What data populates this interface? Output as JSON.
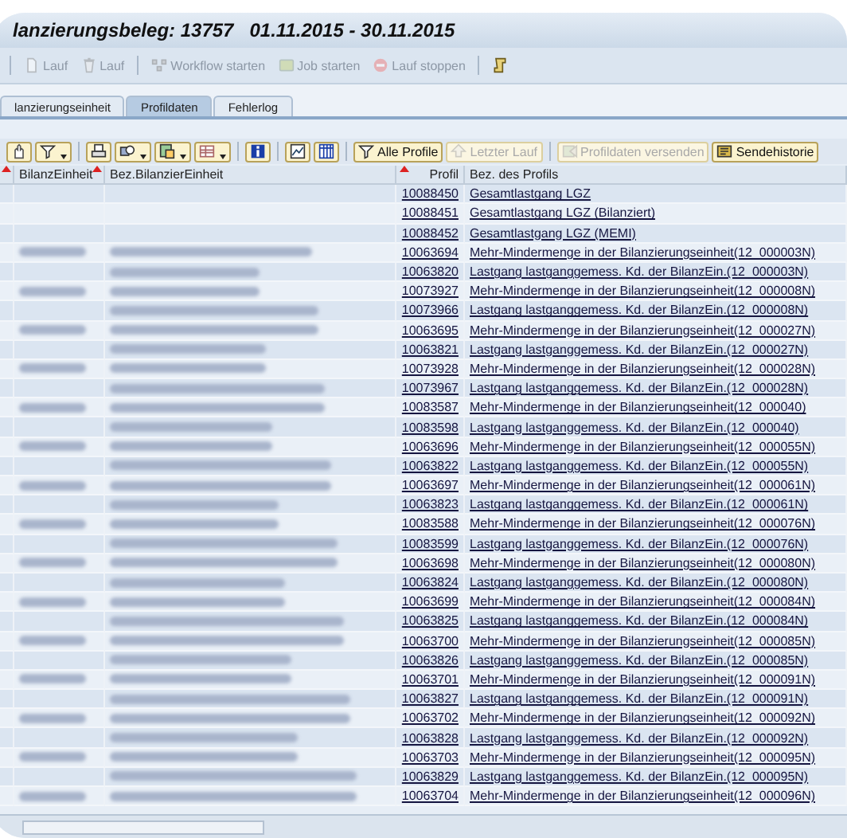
{
  "window": {
    "title": "lanzierungsbeleg: 13757   01.11.2015 - 30.11.2015"
  },
  "toolbar": [
    {
      "kind": "separator"
    },
    {
      "kind": "button",
      "label": "Lauf",
      "disabled": true
    },
    {
      "kind": "button",
      "label": "Lauf",
      "disabled": true
    },
    {
      "kind": "separator"
    },
    {
      "kind": "button",
      "label": "Workflow starten",
      "disabled": true
    },
    {
      "kind": "button",
      "label": "Job starten",
      "disabled": true
    },
    {
      "kind": "button",
      "label": "Lauf stoppen",
      "disabled": true
    },
    {
      "kind": "separator"
    },
    {
      "kind": "button",
      "disabled": false
    }
  ],
  "tabs": [
    {
      "label": "lanzierungseinheit",
      "selected": false
    },
    {
      "label": "Profildaten",
      "selected": true
    },
    {
      "label": "Fehlerlog",
      "selected": false
    }
  ],
  "alv_toolbar": [
    {
      "kind": "button",
      "dropdown": false,
      "disabled": false
    },
    {
      "kind": "button",
      "dropdown": true,
      "disabled": false
    },
    {
      "kind": "separator"
    },
    {
      "kind": "button",
      "dropdown": false,
      "disabled": false
    },
    {
      "kind": "button",
      "dropdown": true,
      "disabled": false
    },
    {
      "kind": "button",
      "dropdown": true,
      "disabled": false
    },
    {
      "kind": "button",
      "dropdown": true,
      "disabled": false
    },
    {
      "kind": "separator"
    },
    {
      "kind": "button",
      "dropdown": false,
      "disabled": false
    },
    {
      "kind": "separator"
    },
    {
      "kind": "button",
      "dropdown": false,
      "disabled": false
    },
    {
      "kind": "button",
      "dropdown": false,
      "disabled": false
    },
    {
      "kind": "separator"
    },
    {
      "kind": "button",
      "label": "Alle Profile",
      "dropdown": false,
      "disabled": false
    },
    {
      "kind": "button",
      "label": "Letzter Lauf",
      "dropdown": false,
      "disabled": true
    },
    {
      "kind": "separator"
    },
    {
      "kind": "button",
      "label": "Profildaten versenden",
      "dropdown": false,
      "disabled": true
    },
    {
      "kind": "button",
      "label": "Sendehistorie",
      "dropdown": false,
      "disabled": false
    }
  ],
  "table": {
    "columns": [
      {
        "sorted": true
      },
      {
        "label": "BilanzEinheit",
        "sorted": true
      },
      {
        "label": "Bez.BilanzierEinheit",
        "sorted": false
      },
      {
        "label": "Profil",
        "sorted": true
      },
      {
        "label": "Bez. des Profils",
        "sorted": false
      }
    ],
    "rows": [
      {
        "unit_redacted": false,
        "name_redacted": false,
        "profil": "10088450",
        "bez": "Gesamtlastgang LGZ"
      },
      {
        "unit_redacted": false,
        "name_redacted": false,
        "profil": "10088451",
        "bez": "Gesamtlastgang LGZ (Bilanziert)"
      },
      {
        "unit_redacted": false,
        "name_redacted": false,
        "profil": "10088452",
        "bez": "Gesamtlastgang LGZ (MEMI)"
      },
      {
        "unit_redacted": true,
        "name_redacted": true,
        "profil": "10063694",
        "bez": "Mehr-Mindermenge in der Bilanzierungseinheit(12_000003N)"
      },
      {
        "unit_redacted": false,
        "name_redacted": true,
        "profil": "10063820",
        "bez": "Lastgang lastganggemess. Kd. der BilanzEin.(12_000003N)"
      },
      {
        "unit_redacted": true,
        "name_redacted": true,
        "profil": "10073927",
        "bez": "Mehr-Mindermenge in der Bilanzierungseinheit(12_000008N)"
      },
      {
        "unit_redacted": false,
        "name_redacted": true,
        "profil": "10073966",
        "bez": "Lastgang lastganggemess. Kd. der BilanzEin.(12_000008N)"
      },
      {
        "unit_redacted": true,
        "name_redacted": true,
        "profil": "10063695",
        "bez": "Mehr-Mindermenge in der Bilanzierungseinheit(12_000027N)"
      },
      {
        "unit_redacted": false,
        "name_redacted": true,
        "profil": "10063821",
        "bez": "Lastgang lastganggemess. Kd. der BilanzEin.(12_000027N)"
      },
      {
        "unit_redacted": true,
        "name_redacted": true,
        "profil": "10073928",
        "bez": "Mehr-Mindermenge in der Bilanzierungseinheit(12_000028N)"
      },
      {
        "unit_redacted": false,
        "name_redacted": true,
        "profil": "10073967",
        "bez": "Lastgang lastganggemess. Kd. der BilanzEin.(12_000028N)"
      },
      {
        "unit_redacted": true,
        "name_redacted": true,
        "profil": "10083587",
        "bez": "Mehr-Mindermenge in der Bilanzierungseinheit(12_000040)"
      },
      {
        "unit_redacted": false,
        "name_redacted": true,
        "profil": "10083598",
        "bez": "Lastgang lastganggemess. Kd. der BilanzEin.(12_000040)"
      },
      {
        "unit_redacted": true,
        "name_redacted": true,
        "profil": "10063696",
        "bez": "Mehr-Mindermenge in der Bilanzierungseinheit(12_000055N)"
      },
      {
        "unit_redacted": false,
        "name_redacted": true,
        "profil": "10063822",
        "bez": "Lastgang lastganggemess. Kd. der BilanzEin.(12_000055N)"
      },
      {
        "unit_redacted": true,
        "name_redacted": true,
        "profil": "10063697",
        "bez": "Mehr-Mindermenge in der Bilanzierungseinheit(12_000061N)"
      },
      {
        "unit_redacted": false,
        "name_redacted": true,
        "profil": "10063823",
        "bez": "Lastgang lastganggemess. Kd. der BilanzEin.(12_000061N)"
      },
      {
        "unit_redacted": true,
        "name_redacted": true,
        "profil": "10083588",
        "bez": "Mehr-Mindermenge in der Bilanzierungseinheit(12_000076N)"
      },
      {
        "unit_redacted": false,
        "name_redacted": true,
        "profil": "10083599",
        "bez": "Lastgang lastganggemess. Kd. der BilanzEin.(12_000076N)"
      },
      {
        "unit_redacted": true,
        "name_redacted": true,
        "profil": "10063698",
        "bez": "Mehr-Mindermenge in der Bilanzierungseinheit(12_000080N)"
      },
      {
        "unit_redacted": false,
        "name_redacted": true,
        "profil": "10063824",
        "bez": "Lastgang lastganggemess. Kd. der BilanzEin.(12_000080N)"
      },
      {
        "unit_redacted": true,
        "name_redacted": true,
        "profil": "10063699",
        "bez": "Mehr-Mindermenge in der Bilanzierungseinheit(12_000084N)"
      },
      {
        "unit_redacted": false,
        "name_redacted": true,
        "profil": "10063825",
        "bez": "Lastgang lastganggemess. Kd. der BilanzEin.(12_000084N)"
      },
      {
        "unit_redacted": true,
        "name_redacted": true,
        "profil": "10063700",
        "bez": "Mehr-Mindermenge in der Bilanzierungseinheit(12_000085N)"
      },
      {
        "unit_redacted": false,
        "name_redacted": true,
        "profil": "10063826",
        "bez": "Lastgang lastganggemess. Kd. der BilanzEin.(12_000085N)"
      },
      {
        "unit_redacted": true,
        "name_redacted": true,
        "profil": "10063701",
        "bez": "Mehr-Mindermenge in der Bilanzierungseinheit(12_000091N)"
      },
      {
        "unit_redacted": false,
        "name_redacted": true,
        "profil": "10063827",
        "bez": "Lastgang lastganggemess. Kd. der BilanzEin.(12_000091N)"
      },
      {
        "unit_redacted": true,
        "name_redacted": true,
        "profil": "10063702",
        "bez": "Mehr-Mindermenge in der Bilanzierungseinheit(12_000092N)"
      },
      {
        "unit_redacted": false,
        "name_redacted": true,
        "profil": "10063828",
        "bez": "Lastgang lastganggemess. Kd. der BilanzEin.(12_000092N)"
      },
      {
        "unit_redacted": true,
        "name_redacted": true,
        "profil": "10063703",
        "bez": "Mehr-Mindermenge in der Bilanzierungseinheit(12_000095N)"
      },
      {
        "unit_redacted": false,
        "name_redacted": true,
        "profil": "10063829",
        "bez": "Lastgang lastganggemess. Kd. der BilanzEin.(12_000095N)"
      },
      {
        "unit_redacted": true,
        "name_redacted": true,
        "profil": "10063704",
        "bez": "Mehr-Mindermenge in der Bilanzierungseinheit(12_000096N)"
      }
    ]
  }
}
